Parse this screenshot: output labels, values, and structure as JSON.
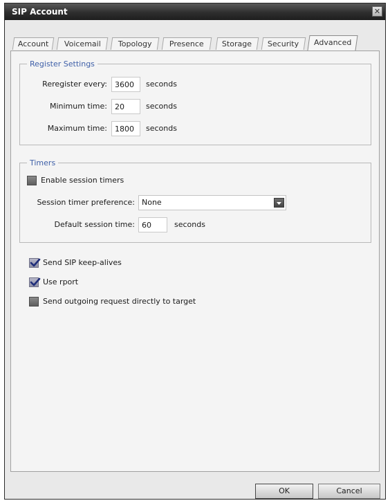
{
  "window": {
    "title": "SIP Account"
  },
  "tabs": [
    "Account",
    "Voicemail",
    "Topology",
    "Presence",
    "Storage",
    "Security",
    "Advanced"
  ],
  "active_tab": "Advanced",
  "register": {
    "title": "Register Settings",
    "reregister_label": "Reregister every:",
    "reregister_value": "3600",
    "minimum_label": "Minimum time:",
    "minimum_value": "20",
    "maximum_label": "Maximum time:",
    "maximum_value": "1800",
    "unit": "seconds"
  },
  "timers": {
    "title": "Timers",
    "enable_label": "Enable session timers",
    "enable_checked": false,
    "preference_label": "Session timer preference:",
    "preference_value": "None",
    "default_label": "Default session time:",
    "default_value": "60",
    "unit": "seconds"
  },
  "options": {
    "keepalives_label": "Send SIP keep-alives",
    "keepalives_checked": true,
    "rport_label": "Use rport",
    "rport_checked": true,
    "direct_label": "Send outgoing request directly to target",
    "direct_checked": false
  },
  "buttons": {
    "ok": "OK",
    "cancel": "Cancel"
  }
}
